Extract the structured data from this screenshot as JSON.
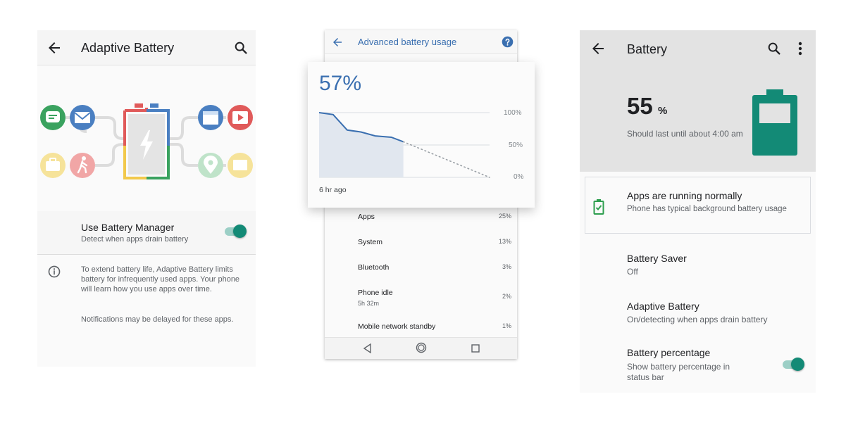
{
  "adaptive": {
    "title": "Adaptive Battery",
    "toggle_title": "Use Battery Manager",
    "toggle_subtitle": "Detect when apps drain battery",
    "toggle_on": true,
    "info_text": "To extend battery life, Adaptive Battery limits battery for infrequently used apps. Your phone will learn how you use apps over time.",
    "info_note": "Notifications may be delayed for these apps.",
    "colors": {
      "accent": "#138a76",
      "blue": "#4a7fc1",
      "red": "#e05a5a",
      "green": "#3aa25f",
      "yellow": "#f2c94c"
    },
    "icons": [
      "back-arrow-icon",
      "search-icon",
      "chat-icon",
      "mail-icon",
      "briefcase-icon",
      "walking-person-icon",
      "battery-bolt-icon",
      "calendar-icon",
      "play-icon",
      "map-pin-icon",
      "message-icon",
      "info-icon"
    ]
  },
  "advanced": {
    "title": "Advanced battery usage",
    "percent": "57%",
    "axis_labels": [
      "100%",
      "50%",
      "0%"
    ],
    "time_label": "6 hr ago",
    "chart_data": {
      "type": "line",
      "y_range": [
        0,
        100
      ],
      "series": [
        {
          "style": "solid",
          "x": [
            0,
            0.7,
            1.4,
            2.1,
            2.8,
            3.6,
            4.2
          ],
          "y": [
            100,
            97,
            73,
            70,
            64,
            62,
            55
          ]
        },
        {
          "style": "dotted",
          "x": [
            4.2,
            8.5
          ],
          "y": [
            55,
            0
          ]
        }
      ]
    },
    "usage": [
      {
        "label": "Apps",
        "sub": "",
        "value": "25%"
      },
      {
        "label": "System",
        "sub": "",
        "value": "13%"
      },
      {
        "label": "Bluetooth",
        "sub": "",
        "value": "3%"
      },
      {
        "label": "Phone idle",
        "sub": "5h 32m",
        "value": "2%"
      },
      {
        "label": "Mobile network standby",
        "sub": "",
        "value": "1%"
      }
    ],
    "colors": {
      "accent": "#3a6fb0",
      "fill": "#e1e7ef"
    },
    "icons": [
      "back-arrow-icon",
      "help-icon",
      "nav-back-icon",
      "nav-home-icon",
      "nav-recents-icon"
    ]
  },
  "battery": {
    "title": "Battery",
    "level": "55",
    "level_unit": "%",
    "last_until": "Should last until about 4:00 am",
    "status_title": "Apps are running normally",
    "status_sub": "Phone has typical background battery usage",
    "saver_title": "Battery Saver",
    "saver_sub": "Off",
    "adaptive_title": "Adaptive Battery",
    "adaptive_sub": "On/detecting when apps drain battery",
    "percentage_title": "Battery percentage",
    "percentage_sub": "Show battery percentage in status bar",
    "percentage_on": true,
    "colors": {
      "battery": "#138a76",
      "ok": "#2e9e4f"
    },
    "icons": [
      "back-arrow-icon",
      "search-icon",
      "more-vert-icon",
      "battery-large-icon",
      "battery-ok-icon"
    ]
  }
}
